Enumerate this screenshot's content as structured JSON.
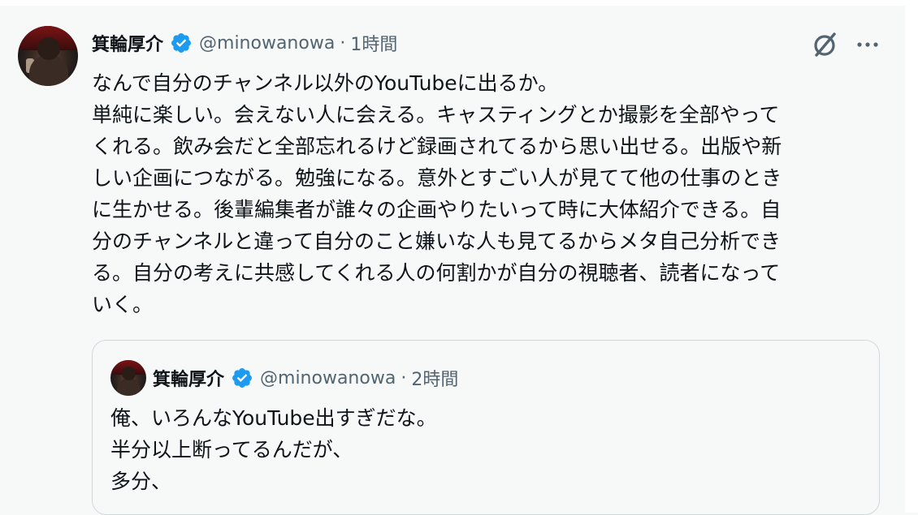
{
  "tweet": {
    "author_name": "箕輪厚介",
    "handle": "@minowanowa",
    "separator": "·",
    "time": "1時間",
    "lines": [
      "なんで自分のチャンネル以外のYouTubeに出るか。",
      "単純に楽しい。会えない人に会える。キャスティングとか撮影を全部やって",
      "くれる。飲み会だと全部忘れるけど録画されてるから思い出せる。出版や新",
      "しい企画につながる。勉強になる。意外とすごい人が見てて他の仕事のとき",
      "に生かせる。後輩編集者が誰々の企画やりたいって時に大体紹介できる。自",
      "分のチャンネルと違って自分のこと嫌いな人も見てるからメタ自己分析でき",
      "る。自分の考えに共感してくれる人の何割かが自分の視聴者、読者になって",
      "いく。"
    ]
  },
  "quote": {
    "author_name": "箕輪厚介",
    "handle": "@minowanowa",
    "separator": "·",
    "time": "2時間",
    "lines": [
      "俺、いろんなYouTube出すぎだな。",
      "半分以上断ってるんだが、",
      "多分、"
    ]
  },
  "icons": {
    "verified": "verified-badge-icon",
    "grok": "grok-icon",
    "more": "more-dots-icon"
  },
  "colors": {
    "verified_blue": "#1d9bf0",
    "secondary_text": "#536471",
    "primary_text": "#0f1419",
    "border": "#cfd9de"
  }
}
